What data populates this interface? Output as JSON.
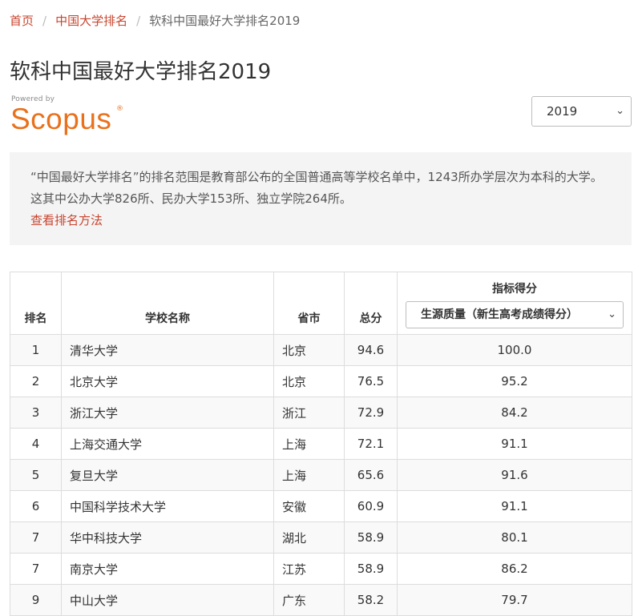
{
  "breadcrumb": {
    "home": "首页",
    "section": "中国大学排名",
    "current": "软科中国最好大学排名2019"
  },
  "page_title": "软科中国最好大学排名2019",
  "logo": {
    "powered_by": "Powered by",
    "brand": "Scopus",
    "reg_mark": "®"
  },
  "year_select": {
    "value": "2019",
    "icon": "chevron-down-icon"
  },
  "note": {
    "text": "“中国最好大学排名”的排名范围是教育部公布的全国普通高等学校名单中，1243所办学层次为本科的大学。这其中公办大学826所、民办大学153所、独立学院264所。",
    "link": "查看排名方法"
  },
  "table": {
    "headers": {
      "rank": "排名",
      "name": "学校名称",
      "province": "省市",
      "total": "总分",
      "indicator": "指标得分"
    },
    "indicator_select": {
      "value": "生源质量（新生高考成绩得分）",
      "icon": "chevron-down-icon"
    },
    "rows": [
      {
        "rank": "1",
        "name": "清华大学",
        "province": "北京",
        "total": "94.6",
        "indicator": "100.0"
      },
      {
        "rank": "2",
        "name": "北京大学",
        "province": "北京",
        "total": "76.5",
        "indicator": "95.2"
      },
      {
        "rank": "3",
        "name": "浙江大学",
        "province": "浙江",
        "total": "72.9",
        "indicator": "84.2"
      },
      {
        "rank": "4",
        "name": "上海交通大学",
        "province": "上海",
        "total": "72.1",
        "indicator": "91.1"
      },
      {
        "rank": "5",
        "name": "复旦大学",
        "province": "上海",
        "total": "65.6",
        "indicator": "91.6"
      },
      {
        "rank": "6",
        "name": "中国科学技术大学",
        "province": "安徽",
        "total": "60.9",
        "indicator": "91.1"
      },
      {
        "rank": "7",
        "name": "华中科技大学",
        "province": "湖北",
        "total": "58.9",
        "indicator": "80.1"
      },
      {
        "rank": "7",
        "name": "南京大学",
        "province": "江苏",
        "total": "58.9",
        "indicator": "86.2"
      },
      {
        "rank": "9",
        "name": "中山大学",
        "province": "广东",
        "total": "58.2",
        "indicator": "79.7"
      }
    ]
  },
  "colors": {
    "link": "#c9452f",
    "brand": "#e9711c",
    "note_bg": "#f4f4f4",
    "stripe": "#f9f9f9",
    "border": "#dddddd"
  }
}
